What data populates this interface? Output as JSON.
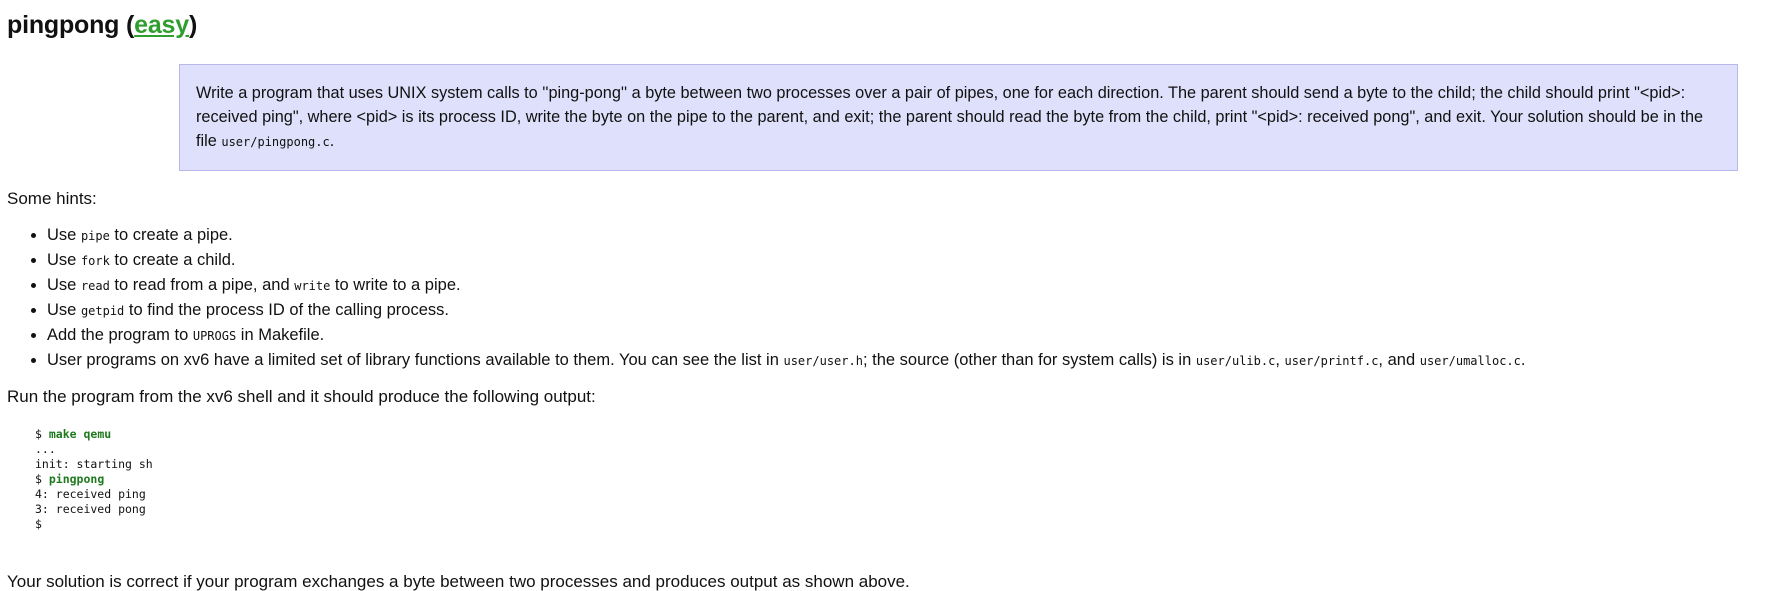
{
  "title": {
    "name": "pingpong",
    "open_paren": " (",
    "difficulty": "easy",
    "close_paren": ")"
  },
  "assignment": {
    "text_1": "Write a program that uses UNIX system calls to ''ping-pong'' a byte between two processes over a pair of pipes, one for each direction. The parent should send a byte to the child; the child should print \"<pid>: received ping\", where <pid> is its process ID, write the byte on the pipe to the parent, and exit; the parent should read the byte from the child, print \"<pid>: received pong\", and exit. Your solution should be in the file ",
    "file": "user/pingpong.c",
    "text_2": "."
  },
  "hints_intro": "Some hints:",
  "hints": [
    {
      "pre": "Use ",
      "code": "pipe",
      "post": " to create a pipe."
    },
    {
      "pre": "Use ",
      "code": "fork",
      "post": " to create a child."
    },
    {
      "pre": "Use ",
      "code": "read",
      "mid": " to read from a pipe, and ",
      "code2": "write",
      "post": " to write to a pipe."
    },
    {
      "pre": "Use ",
      "code": "getpid",
      "post": " to find the process ID of the calling process."
    },
    {
      "pre": "Add the program to ",
      "code": "UPROGS",
      "post": " in Makefile."
    },
    {
      "pre": "User programs on xv6 have a limited set of library functions available to them. You can see the list in ",
      "code": "user/user.h",
      "mid": "; the source (other than for system calls) is in ",
      "code2": "user/ulib.c",
      "sep2": ", ",
      "code3": "user/printf.c",
      "sep3": ", and ",
      "code4": "user/umalloc.c",
      "post": "."
    }
  ],
  "run_intro": "Run the program from the xv6 shell and it should produce the following output:",
  "output": {
    "prompt_1": "$ ",
    "cmd_1": "make qemu",
    "line_2": "...",
    "line_3": "init: starting sh",
    "prompt_4": "$ ",
    "cmd_4": "pingpong",
    "line_5": "4: received ping",
    "line_6": "3: received pong",
    "line_7": "$"
  },
  "conclusion": "Your solution is correct if your program exchanges a byte between two processes and produces output as shown above."
}
